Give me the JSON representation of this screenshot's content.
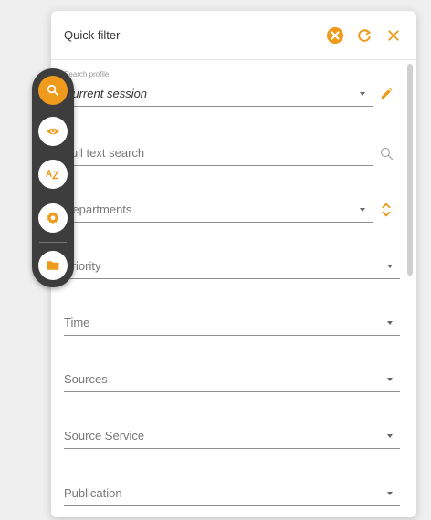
{
  "panel": {
    "title": "Quick filter",
    "colors": {
      "accent": "#ef9a1a",
      "text": "#333333",
      "muted": "#777777"
    }
  },
  "header_buttons": [
    {
      "name": "clear",
      "icon": "clear-circle-icon"
    },
    {
      "name": "refresh",
      "icon": "refresh-icon"
    },
    {
      "name": "close",
      "icon": "close-icon"
    }
  ],
  "fields": {
    "search_profile": {
      "label": "Search profile",
      "value": "Current session"
    },
    "full_text_search": {
      "placeholder": "Full text search"
    },
    "departments": {
      "placeholder": "Departments"
    },
    "priority": {
      "placeholder": "Priority"
    },
    "time": {
      "placeholder": "Time"
    },
    "sources": {
      "placeholder": "Sources"
    },
    "source_service": {
      "placeholder": "Source Service"
    },
    "publication": {
      "placeholder": "Publication"
    }
  },
  "toolbar": [
    {
      "name": "search",
      "icon": "search-icon",
      "active": true
    },
    {
      "name": "view",
      "icon": "eye-icon",
      "active": false
    },
    {
      "name": "sort",
      "icon": "sort-az-icon",
      "active": false
    },
    {
      "name": "settings",
      "icon": "gear-icon",
      "active": false
    },
    {
      "name": "folder",
      "icon": "folder-icon",
      "active": false
    }
  ]
}
